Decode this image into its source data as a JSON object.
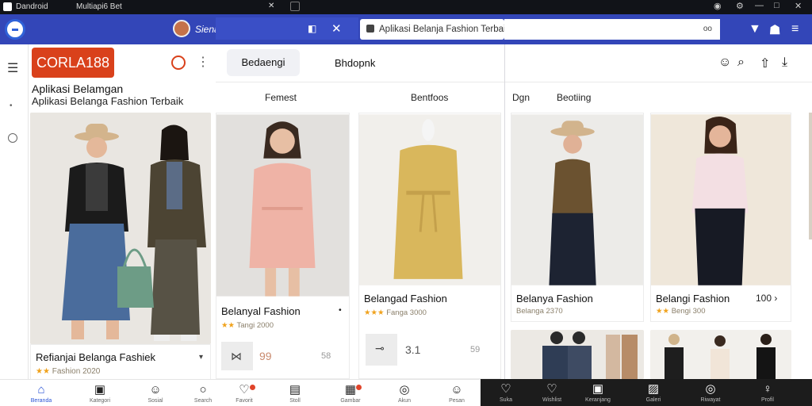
{
  "os_titlebar": {
    "left_title": "Dandroid",
    "center_title": "Multiapi6 Bet",
    "window_controls": [
      "—",
      "□",
      "✕"
    ]
  },
  "browser": {
    "profile_name": "Sienan",
    "url": "Aplikasi Belanja Fashion Terbaik",
    "url_secondary_label": "oo"
  },
  "app": {
    "logo_text": "CORLA188",
    "title": "Aplikasi Belamgan",
    "subtitle": "Aplikasi Belanga Fashion Terbaik",
    "hero_caption": {
      "name": "Refianjai Belanga Fashiek",
      "rating_text": "Fashion 2020",
      "stars": "★★"
    }
  },
  "tabs": [
    {
      "label": "Bedaengi",
      "active": true
    },
    {
      "label": "Bhdopnk",
      "active": false
    }
  ],
  "categories": [
    "Femest",
    "Bentfoos",
    "Dgn",
    "Beotiing"
  ],
  "products": [
    {
      "name": "Belanyal Fashion",
      "stars": "★★",
      "rating_text": "Tangi 2000",
      "side_text": "•"
    },
    {
      "name": "Belangad Fashion",
      "stars": "★★★",
      "rating_text": "Fanga 3000",
      "side_text": ""
    },
    {
      "name": "Belanya Fashion",
      "stars": "",
      "rating_text": "Belanga 2370",
      "side_text": ""
    },
    {
      "name": "Belangi Fashion",
      "stars": "★★",
      "rating_text": "Bengi 300",
      "side_text": "100 ›"
    }
  ],
  "mini_cards": [
    {
      "price": "99",
      "side": "58"
    },
    {
      "price": "3.1",
      "side": "59"
    }
  ],
  "bottom_nav": [
    {
      "icon": "home-icon",
      "glyph": "⌂",
      "label": "Beranda",
      "active": true
    },
    {
      "icon": "bag-icon",
      "glyph": "▣",
      "label": "Kategori",
      "active": false
    },
    {
      "icon": "smile-icon",
      "glyph": "☺",
      "label": "Sosial",
      "active": false
    },
    {
      "icon": "search-icon",
      "glyph": "○",
      "label": "Search",
      "active": false
    },
    {
      "icon": "heart-icon",
      "glyph": "♡",
      "label": "Favorit",
      "active": false,
      "badge": true
    },
    {
      "icon": "wallet-icon",
      "glyph": "▤",
      "label": "Stoll",
      "active": false
    },
    {
      "icon": "chat-icon",
      "glyph": "▦",
      "label": "Gambar",
      "active": false,
      "badge": true
    },
    {
      "icon": "profile-icon",
      "glyph": "◎",
      "label": "Akun",
      "active": false
    },
    {
      "icon": "message-icon",
      "glyph": "☺",
      "label": "Pesan",
      "active": false
    },
    {
      "icon": "heart-icon",
      "glyph": "♡",
      "label": "Suka",
      "active": false
    },
    {
      "icon": "heart-icon",
      "glyph": "♡",
      "label": "Wishlist",
      "active": false
    },
    {
      "icon": "box-icon",
      "glyph": "▣",
      "label": "Keranjang",
      "active": false
    },
    {
      "icon": "image-icon",
      "glyph": "▨",
      "label": "Galeri",
      "active": false
    },
    {
      "icon": "clock-icon",
      "glyph": "◎",
      "label": "Riwayat",
      "active": false
    },
    {
      "icon": "user-icon",
      "glyph": "♀",
      "label": "Profil",
      "active": false
    }
  ],
  "colors": {
    "toolbar_blue": "#3346b8",
    "brand_red": "#d9411b",
    "star_gold": "#f0a21c",
    "active_blue": "#2b55d6"
  }
}
